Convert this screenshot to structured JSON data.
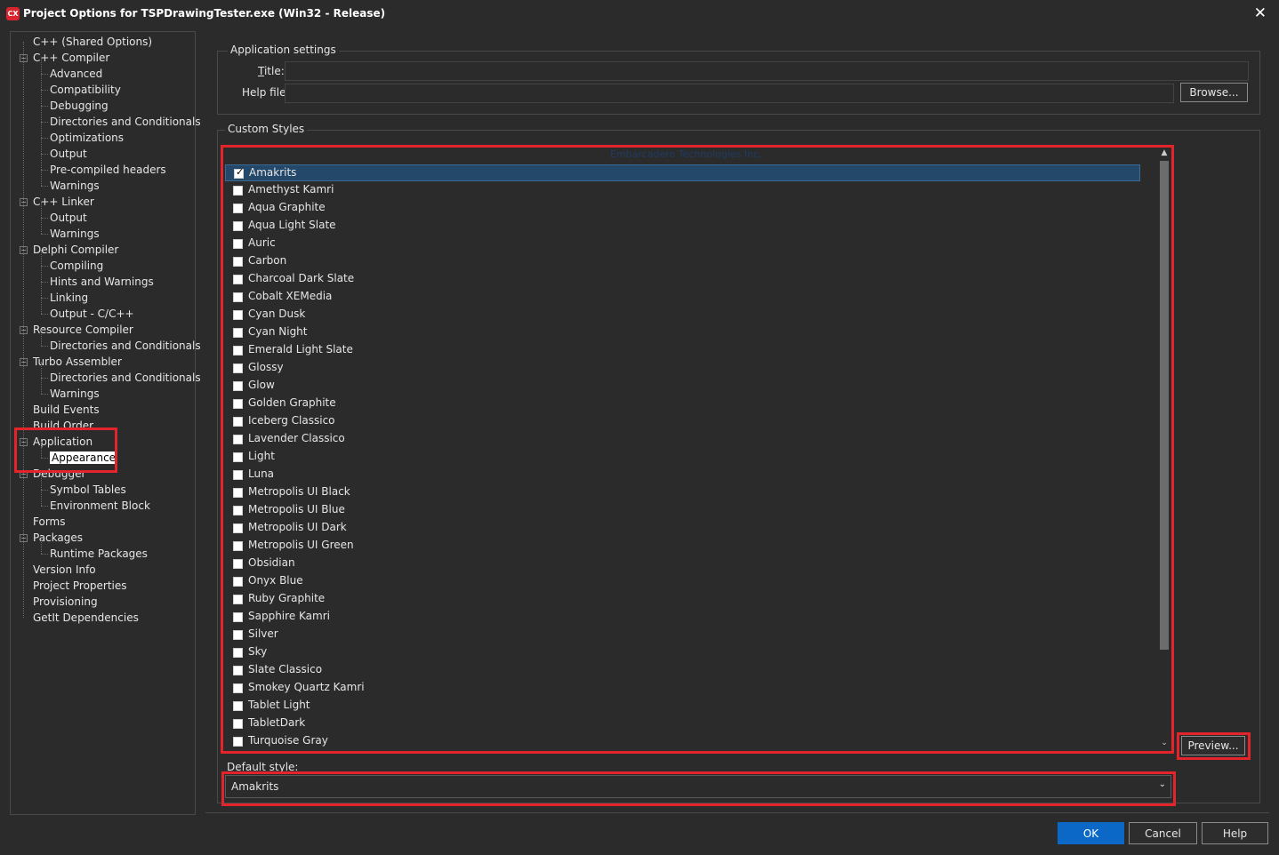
{
  "window": {
    "icon_text": "CX",
    "title": "Project Options for TSPDrawingTester.exe  (Win32 - Release)"
  },
  "tree": {
    "items": [
      {
        "label": "C++ (Shared Options)"
      },
      {
        "label": "C++ Compiler"
      },
      {
        "label": "Advanced"
      },
      {
        "label": "Compatibility"
      },
      {
        "label": "Debugging"
      },
      {
        "label": "Directories and Conditionals"
      },
      {
        "label": "Optimizations"
      },
      {
        "label": "Output"
      },
      {
        "label": "Pre-compiled headers"
      },
      {
        "label": "Warnings"
      },
      {
        "label": "C++ Linker"
      },
      {
        "label": "Output"
      },
      {
        "label": "Warnings"
      },
      {
        "label": "Delphi Compiler"
      },
      {
        "label": "Compiling"
      },
      {
        "label": "Hints and Warnings"
      },
      {
        "label": "Linking"
      },
      {
        "label": "Output - C/C++"
      },
      {
        "label": "Resource Compiler"
      },
      {
        "label": "Directories and Conditionals"
      },
      {
        "label": "Turbo Assembler"
      },
      {
        "label": "Directories and Conditionals"
      },
      {
        "label": "Warnings"
      },
      {
        "label": "Build Events"
      },
      {
        "label": "Build Order"
      },
      {
        "label": "Application"
      },
      {
        "label": "Appearance"
      },
      {
        "label": "Debugger"
      },
      {
        "label": "Symbol Tables"
      },
      {
        "label": "Environment Block"
      },
      {
        "label": "Forms"
      },
      {
        "label": "Packages"
      },
      {
        "label": "Runtime Packages"
      },
      {
        "label": "Version Info"
      },
      {
        "label": "Project Properties"
      },
      {
        "label": "Provisioning"
      },
      {
        "label": "GetIt Dependencies"
      }
    ]
  },
  "app_settings": {
    "group_label": "Application settings",
    "title_label": "Title:",
    "title_value": "",
    "helpfile_label": "Help file:",
    "helpfile_value": "",
    "browse_label": "Browse..."
  },
  "custom_styles": {
    "group_label": "Custom Styles",
    "watermark": "Embarcadero Technologies Inc.",
    "styles": [
      {
        "name": "Amakrits",
        "checked": true
      },
      {
        "name": "Amethyst Kamri",
        "checked": false
      },
      {
        "name": "Aqua Graphite",
        "checked": false
      },
      {
        "name": "Aqua Light Slate",
        "checked": false
      },
      {
        "name": "Auric",
        "checked": false
      },
      {
        "name": "Carbon",
        "checked": false
      },
      {
        "name": "Charcoal Dark Slate",
        "checked": false
      },
      {
        "name": "Cobalt XEMedia",
        "checked": false
      },
      {
        "name": "Cyan Dusk",
        "checked": false
      },
      {
        "name": "Cyan Night",
        "checked": false
      },
      {
        "name": "Emerald Light Slate",
        "checked": false
      },
      {
        "name": "Glossy",
        "checked": false
      },
      {
        "name": "Glow",
        "checked": false
      },
      {
        "name": "Golden Graphite",
        "checked": false
      },
      {
        "name": "Iceberg Classico",
        "checked": false
      },
      {
        "name": "Lavender Classico",
        "checked": false
      },
      {
        "name": "Light",
        "checked": false
      },
      {
        "name": "Luna",
        "checked": false
      },
      {
        "name": "Metropolis UI Black",
        "checked": false
      },
      {
        "name": "Metropolis UI Blue",
        "checked": false
      },
      {
        "name": "Metropolis UI Dark",
        "checked": false
      },
      {
        "name": "Metropolis UI Green",
        "checked": false
      },
      {
        "name": "Obsidian",
        "checked": false
      },
      {
        "name": "Onyx Blue",
        "checked": false
      },
      {
        "name": "Ruby Graphite",
        "checked": false
      },
      {
        "name": "Sapphire Kamri",
        "checked": false
      },
      {
        "name": "Silver",
        "checked": false
      },
      {
        "name": "Sky",
        "checked": false
      },
      {
        "name": "Slate Classico",
        "checked": false
      },
      {
        "name": "Smokey Quartz Kamri",
        "checked": false
      },
      {
        "name": "Tablet Light",
        "checked": false
      },
      {
        "name": "TabletDark",
        "checked": false
      },
      {
        "name": "Turquoise Gray",
        "checked": false
      }
    ],
    "preview_label": "Preview...",
    "default_style_label": "Default style:",
    "default_style_value": "Amakrits"
  },
  "buttons": {
    "ok": "OK",
    "cancel": "Cancel",
    "help": "Help"
  },
  "colors": {
    "background": "#2b2b2b",
    "highlight_red": "#e3242b",
    "ok_blue": "#0b68c7",
    "selected_row": "#23486a"
  }
}
